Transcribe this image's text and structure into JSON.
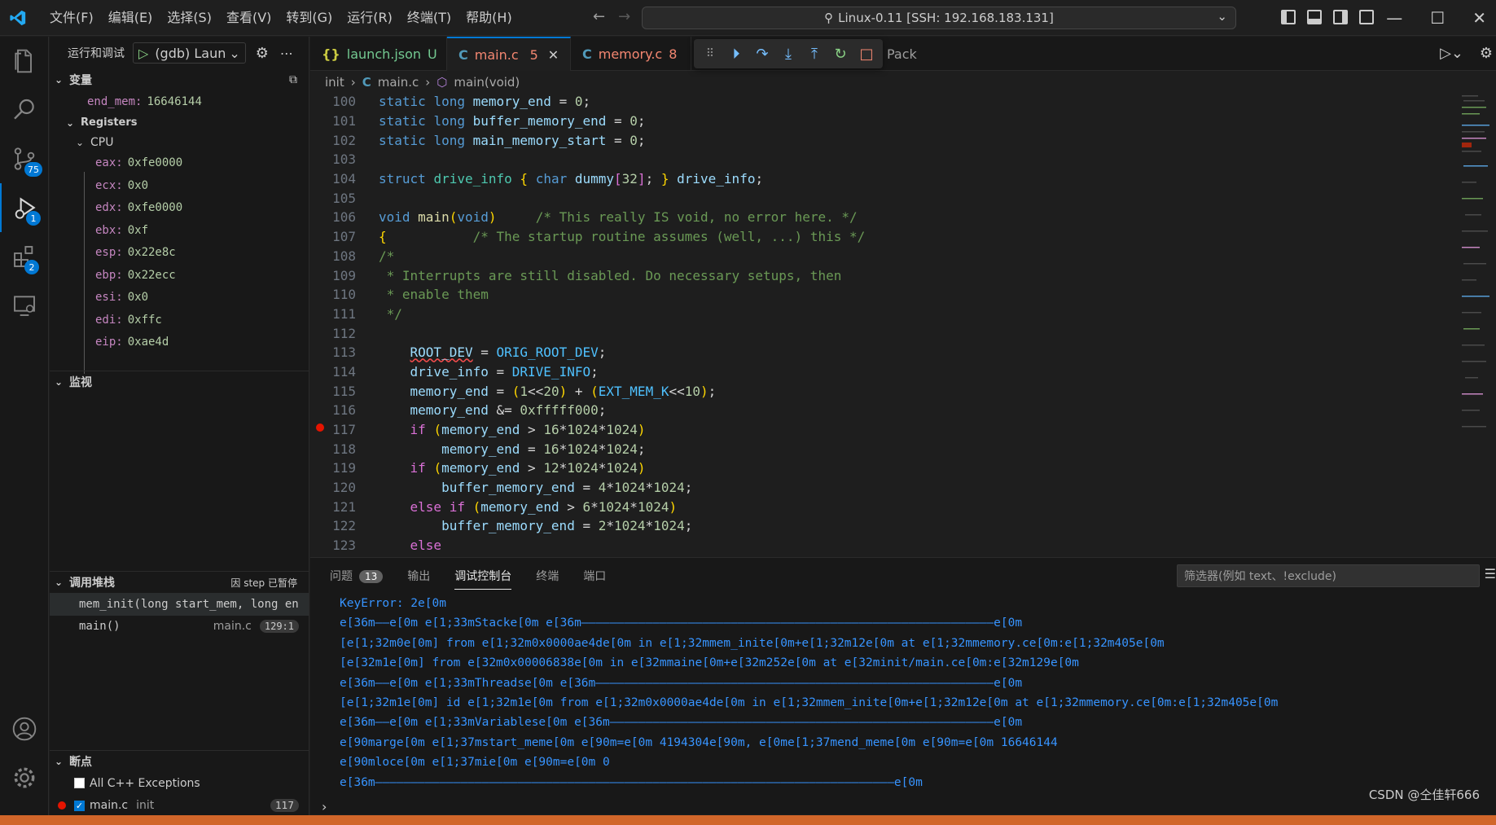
{
  "menu": {
    "items": [
      "文件(F)",
      "编辑(E)",
      "选择(S)",
      "查看(V)",
      "转到(G)",
      "运行(R)",
      "终端(T)",
      "帮助(H)"
    ]
  },
  "command_center": {
    "text": "Linux-0.11 [SSH: 192.168.183.131]"
  },
  "activity_badges": {
    "scm": "75",
    "debug": "1",
    "extensions": "2"
  },
  "sidebar": {
    "title": "运行和调试",
    "config": "(gdb) Laun",
    "variables_title": "变量",
    "end_mem": {
      "name": "end_mem:",
      "value": "16646144"
    },
    "registers_title": "Registers",
    "cpu_title": "CPU",
    "registers": [
      {
        "name": "eax:",
        "value": "0xfe0000"
      },
      {
        "name": "ecx:",
        "value": "0x0"
      },
      {
        "name": "edx:",
        "value": "0xfe0000"
      },
      {
        "name": "ebx:",
        "value": "0xf"
      },
      {
        "name": "esp:",
        "value": "0x22e8c"
      },
      {
        "name": "ebp:",
        "value": "0x22ecc"
      },
      {
        "name": "esi:",
        "value": "0x0"
      },
      {
        "name": "edi:",
        "value": "0xffc"
      },
      {
        "name": "eip:",
        "value": "0xae4d"
      }
    ],
    "watch_title": "监视",
    "callstack_title": "调用堆栈",
    "callstack_status": "因 step 已暂停",
    "frames": [
      {
        "name": "mem_init(long start_mem, long en",
        "file": "",
        "pos": ""
      },
      {
        "name": "main()",
        "file": "main.c",
        "pos": "129:1"
      }
    ],
    "breakpoints_title": "断点",
    "bp_exceptions": "All C++ Exceptions",
    "bp_file": "main.c",
    "bp_folder": "init",
    "bp_line": "117"
  },
  "tabs": [
    {
      "icon": "{}",
      "label": "launch.json",
      "suffix": "U"
    },
    {
      "icon": "C",
      "label": "main.c",
      "suffix": "5"
    },
    {
      "icon": "C",
      "label": "memory.c",
      "suffix": "8"
    },
    {
      "icon": "",
      "label": "Pack",
      "suffix": ""
    }
  ],
  "breadcrumbs": {
    "folder": "init",
    "file": "main.c",
    "symbol": "main(void)"
  },
  "code_lines": [
    "100",
    "101",
    "102",
    "103",
    "104",
    "105",
    "106",
    "107",
    "108",
    "109",
    "110",
    "111",
    "112",
    "113",
    "114",
    "115",
    "116",
    "117",
    "118",
    "119",
    "120",
    "121",
    "122",
    "123"
  ],
  "panel": {
    "tabs": [
      "问题",
      "输出",
      "调试控制台",
      "终端",
      "端口"
    ],
    "problems_count": "13",
    "filter_placeholder": "筛选器(例如 text、!exclude)",
    "console_lines": [
      "KeyError: 2e[0m",
      "e[36m——e[0m e[1;33mStacke[0m e[36m——————————————————————————————————————————————————————————e[0m",
      "[e[1;32m0e[0m] from e[1;32m0x0000ae4de[0m in e[1;32mmem_inite[0m+e[1;32m12e[0m at e[1;32mmemory.ce[0m:e[1;32m405e[0m",
      "[e[32m1e[0m] from e[32m0x00006838e[0m in e[32mmaine[0m+e[32m252e[0m at e[32minit/main.ce[0m:e[32m129e[0m",
      "e[36m——e[0m e[1;33mThreadse[0m e[36m————————————————————————————————————————————————————————e[0m",
      "[e[1;32m1e[0m] id e[1;32m1e[0m from e[1;32m0x0000ae4de[0m in e[1;32mmem_inite[0m+e[1;32m12e[0m at e[1;32mmemory.ce[0m:e[1;32m405e[0m",
      "e[36m——e[0m e[1;33mVariablese[0m e[36m——————————————————————————————————————————————————————e[0m",
      "e[90marge[0m e[1;37mstart_meme[0m e[90m=e[0m 4194304e[90m, e[0me[1;37mend_meme[0m e[90m=e[0m 16646144",
      "e[90mloce[0m e[1;37mie[0m e[90m=e[0m 0",
      "e[36m—————————————————————————————————————————————————————————————————————————e[0m"
    ]
  },
  "watermark": "CSDN @仝佳轩666"
}
